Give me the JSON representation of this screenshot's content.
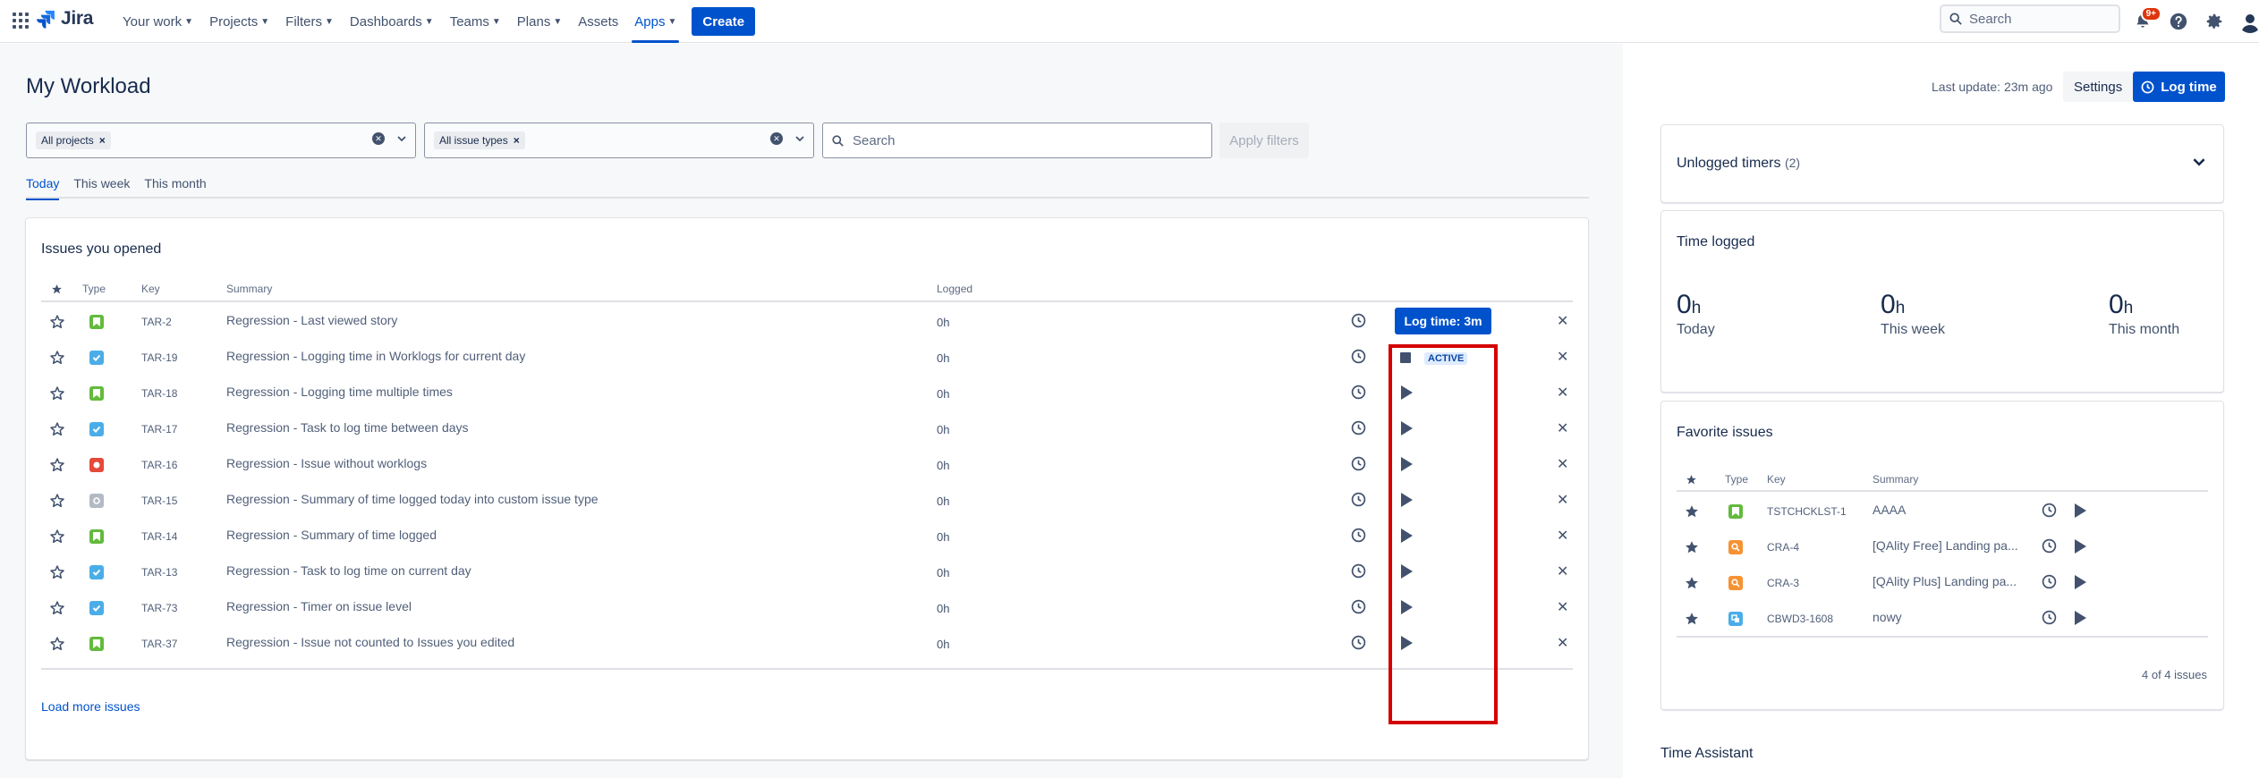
{
  "nav": {
    "logo": "Jira",
    "items": [
      {
        "label": "Your work",
        "chevron": true,
        "active": false
      },
      {
        "label": "Projects",
        "chevron": true,
        "active": false
      },
      {
        "label": "Filters",
        "chevron": true,
        "active": false
      },
      {
        "label": "Dashboards",
        "chevron": true,
        "active": false
      },
      {
        "label": "Teams",
        "chevron": true,
        "active": false
      },
      {
        "label": "Plans",
        "chevron": true,
        "active": false
      },
      {
        "label": "Assets",
        "chevron": false,
        "active": false
      },
      {
        "label": "Apps",
        "chevron": true,
        "active": true
      }
    ],
    "create_label": "Create",
    "search_placeholder": "Search",
    "notifications_badge": "9+"
  },
  "page": {
    "title": "My Workload",
    "filters": {
      "projects_chip": "All projects",
      "issue_types_chip": "All issue types",
      "search_placeholder": "Search",
      "apply_label": "Apply filters"
    },
    "tabs": [
      {
        "label": "Today",
        "active": true
      },
      {
        "label": "This week",
        "active": false
      },
      {
        "label": "This month",
        "active": false
      }
    ]
  },
  "issues_opened": {
    "title": "Issues you opened",
    "columns": {
      "type": "Type",
      "key": "Key",
      "summary": "Summary",
      "logged": "Logged"
    },
    "rows": [
      {
        "type": "story",
        "key": "TAR-2",
        "summary": "Regression - Last viewed story",
        "logged": "0h",
        "action": "logtime"
      },
      {
        "type": "task",
        "key": "TAR-19",
        "summary": "Regression - Logging time in Worklogs for current day",
        "logged": "0h",
        "action": "active"
      },
      {
        "type": "story",
        "key": "TAR-18",
        "summary": "Regression - Logging time multiple times",
        "logged": "0h",
        "action": "play"
      },
      {
        "type": "task",
        "key": "TAR-17",
        "summary": "Regression - Task to log time between days",
        "logged": "0h",
        "action": "play"
      },
      {
        "type": "bug",
        "key": "TAR-16",
        "summary": "Regression - Issue without worklogs",
        "logged": "0h",
        "action": "play"
      },
      {
        "type": "custom",
        "key": "TAR-15",
        "summary": "Regression - Summary of time logged today into custom issue type",
        "logged": "0h",
        "action": "play"
      },
      {
        "type": "story",
        "key": "TAR-14",
        "summary": "Regression - Summary of time logged",
        "logged": "0h",
        "action": "play"
      },
      {
        "type": "task",
        "key": "TAR-13",
        "summary": "Regression - Task to log time on current day",
        "logged": "0h",
        "action": "play"
      },
      {
        "type": "task",
        "key": "TAR-73",
        "summary": "Regression - Timer on issue level",
        "logged": "0h",
        "action": "play"
      },
      {
        "type": "story",
        "key": "TAR-37",
        "summary": "Regression - Issue not counted to Issues you edited",
        "logged": "0h",
        "action": "play"
      }
    ],
    "logtime_label": "Log time: 3m",
    "active_label": "ACTIVE",
    "load_more": "Load more issues"
  },
  "right": {
    "last_update": "Last update: 23m ago",
    "settings_label": "Settings",
    "logtime_label": "Log time",
    "unlogged_title": "Unlogged timers",
    "unlogged_count": "(2)",
    "time_logged_title": "Time logged",
    "stats": [
      {
        "value": "0",
        "unit": "h",
        "label": "Today"
      },
      {
        "value": "0",
        "unit": "h",
        "label": "This week"
      },
      {
        "value": "0",
        "unit": "h",
        "label": "This month"
      }
    ],
    "favorites": {
      "title": "Favorite issues",
      "columns": {
        "type": "Type",
        "key": "Key",
        "summary": "Summary"
      },
      "rows": [
        {
          "type": "story",
          "key": "TSTCHCKLST-1",
          "summary": "AAAA"
        },
        {
          "type": "search",
          "key": "CRA-4",
          "summary": "[QAlity Free] Landing pa..."
        },
        {
          "type": "search",
          "key": "CRA-3",
          "summary": "[QAlity Plus] Landing pa..."
        },
        {
          "type": "subtask",
          "key": "CBWD3-1608",
          "summary": "nowy"
        }
      ],
      "count_label": "4 of 4 issues"
    },
    "time_assistant": "Time Assistant"
  },
  "colors": {
    "primary": "#0052cc",
    "highlight": "#d40000",
    "story": "#63ba3c",
    "task": "#4bade8",
    "bug": "#e5493a",
    "custom": "#b3bac5",
    "search": "#f79232"
  }
}
